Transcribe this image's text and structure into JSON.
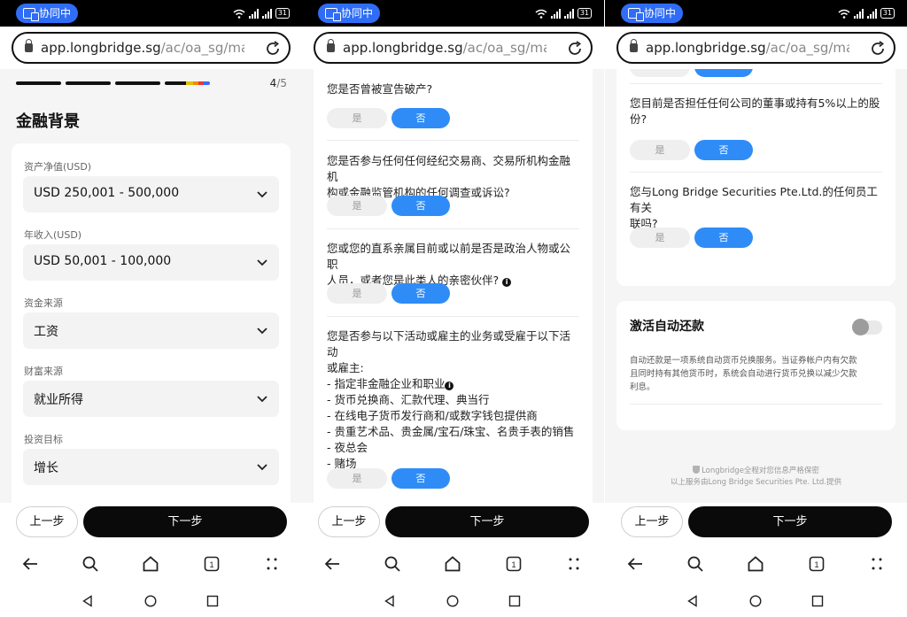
{
  "status": {
    "collab_label": "协同中",
    "battery": "31"
  },
  "browser": {
    "url_domain": "app.longbridge.sg",
    "url_path": "/ac/oa_sg/manual/fi"
  },
  "screen1": {
    "step_current": "4",
    "step_total": "/5",
    "title": "金融背景",
    "fields": [
      {
        "label": "资产净值(USD)",
        "value": "USD 250,001 - 500,000"
      },
      {
        "label": "年收入(USD)",
        "value": "USD 50,001 - 100,000"
      },
      {
        "label": "资金来源",
        "value": "工资"
      },
      {
        "label": "财富来源",
        "value": "就业所得"
      },
      {
        "label": "投资目标",
        "value": "增长"
      }
    ]
  },
  "screen2": {
    "questions": [
      {
        "lines": [
          "您是否曾被宣告破产?"
        ]
      },
      {
        "lines": [
          "您是否参与任何任何经纪交易商、交易所机构金融机",
          "构或金融监管机构的任何调查或诉讼?"
        ]
      },
      {
        "lines": [
          "您或您的直系亲属目前或以前是否是政治人物或公职",
          "人员，或者您是此类人的亲密伙伴?"
        ]
      },
      {
        "lines": [
          "您是否参与以下活动或雇主的业务或受雇于以下活动",
          "或雇主:",
          "- 指定非金融企业和职业",
          "- 货币兑换商、汇款代理、典当行",
          "- 在线电子货币发行商和/或数字钱包提供商",
          "- 贵重艺术品、贵金属/宝石/珠宝、名贵手表的销售",
          "- 夜总会",
          "- 赌场"
        ]
      }
    ]
  },
  "screen3": {
    "questions": [
      {
        "lines": [
          "您目前是否担任任何公司的董事或持有5%以上的股",
          "份?"
        ]
      },
      {
        "lines": [
          "您与Long Bridge Securities Pte.Ltd.的任何员工有关",
          "联吗?"
        ]
      }
    ],
    "auto_title": "激活自动还款",
    "auto_desc": [
      "自动还款是一项系统自动货币兑换服务。当证券帐户内有欠款",
      "且同时持有其他货币时，系统会自动进行货币兑换以减少欠款",
      "利息。"
    ],
    "footer_line1": "Longbridge全程对您信息严格保密",
    "footer_line2": "以上服务由Long Bridge Securities Pte. Ltd.提供"
  },
  "buttons": {
    "yes": "是",
    "no": "否",
    "prev": "上一步",
    "next": "下一步"
  },
  "tab_count": "1",
  "icons": {
    "collab": "screen-share-icon",
    "wifi": "wifi-icon",
    "signal": "signal-icon",
    "battery": "battery-icon",
    "lock": "lock-icon",
    "reload": "reload-icon",
    "chevron": "chevron-down-icon",
    "info": "info-icon",
    "back": "back-arrow-icon",
    "search": "search-icon",
    "home": "home-icon",
    "tabs": "tabs-icon",
    "menu": "more-dots-icon",
    "shield": "shield-icon"
  },
  "colors": {
    "primary_blue": "#2f8cf7",
    "black_button": "#0a0a0a",
    "collab_blue": "#2f6df6"
  }
}
